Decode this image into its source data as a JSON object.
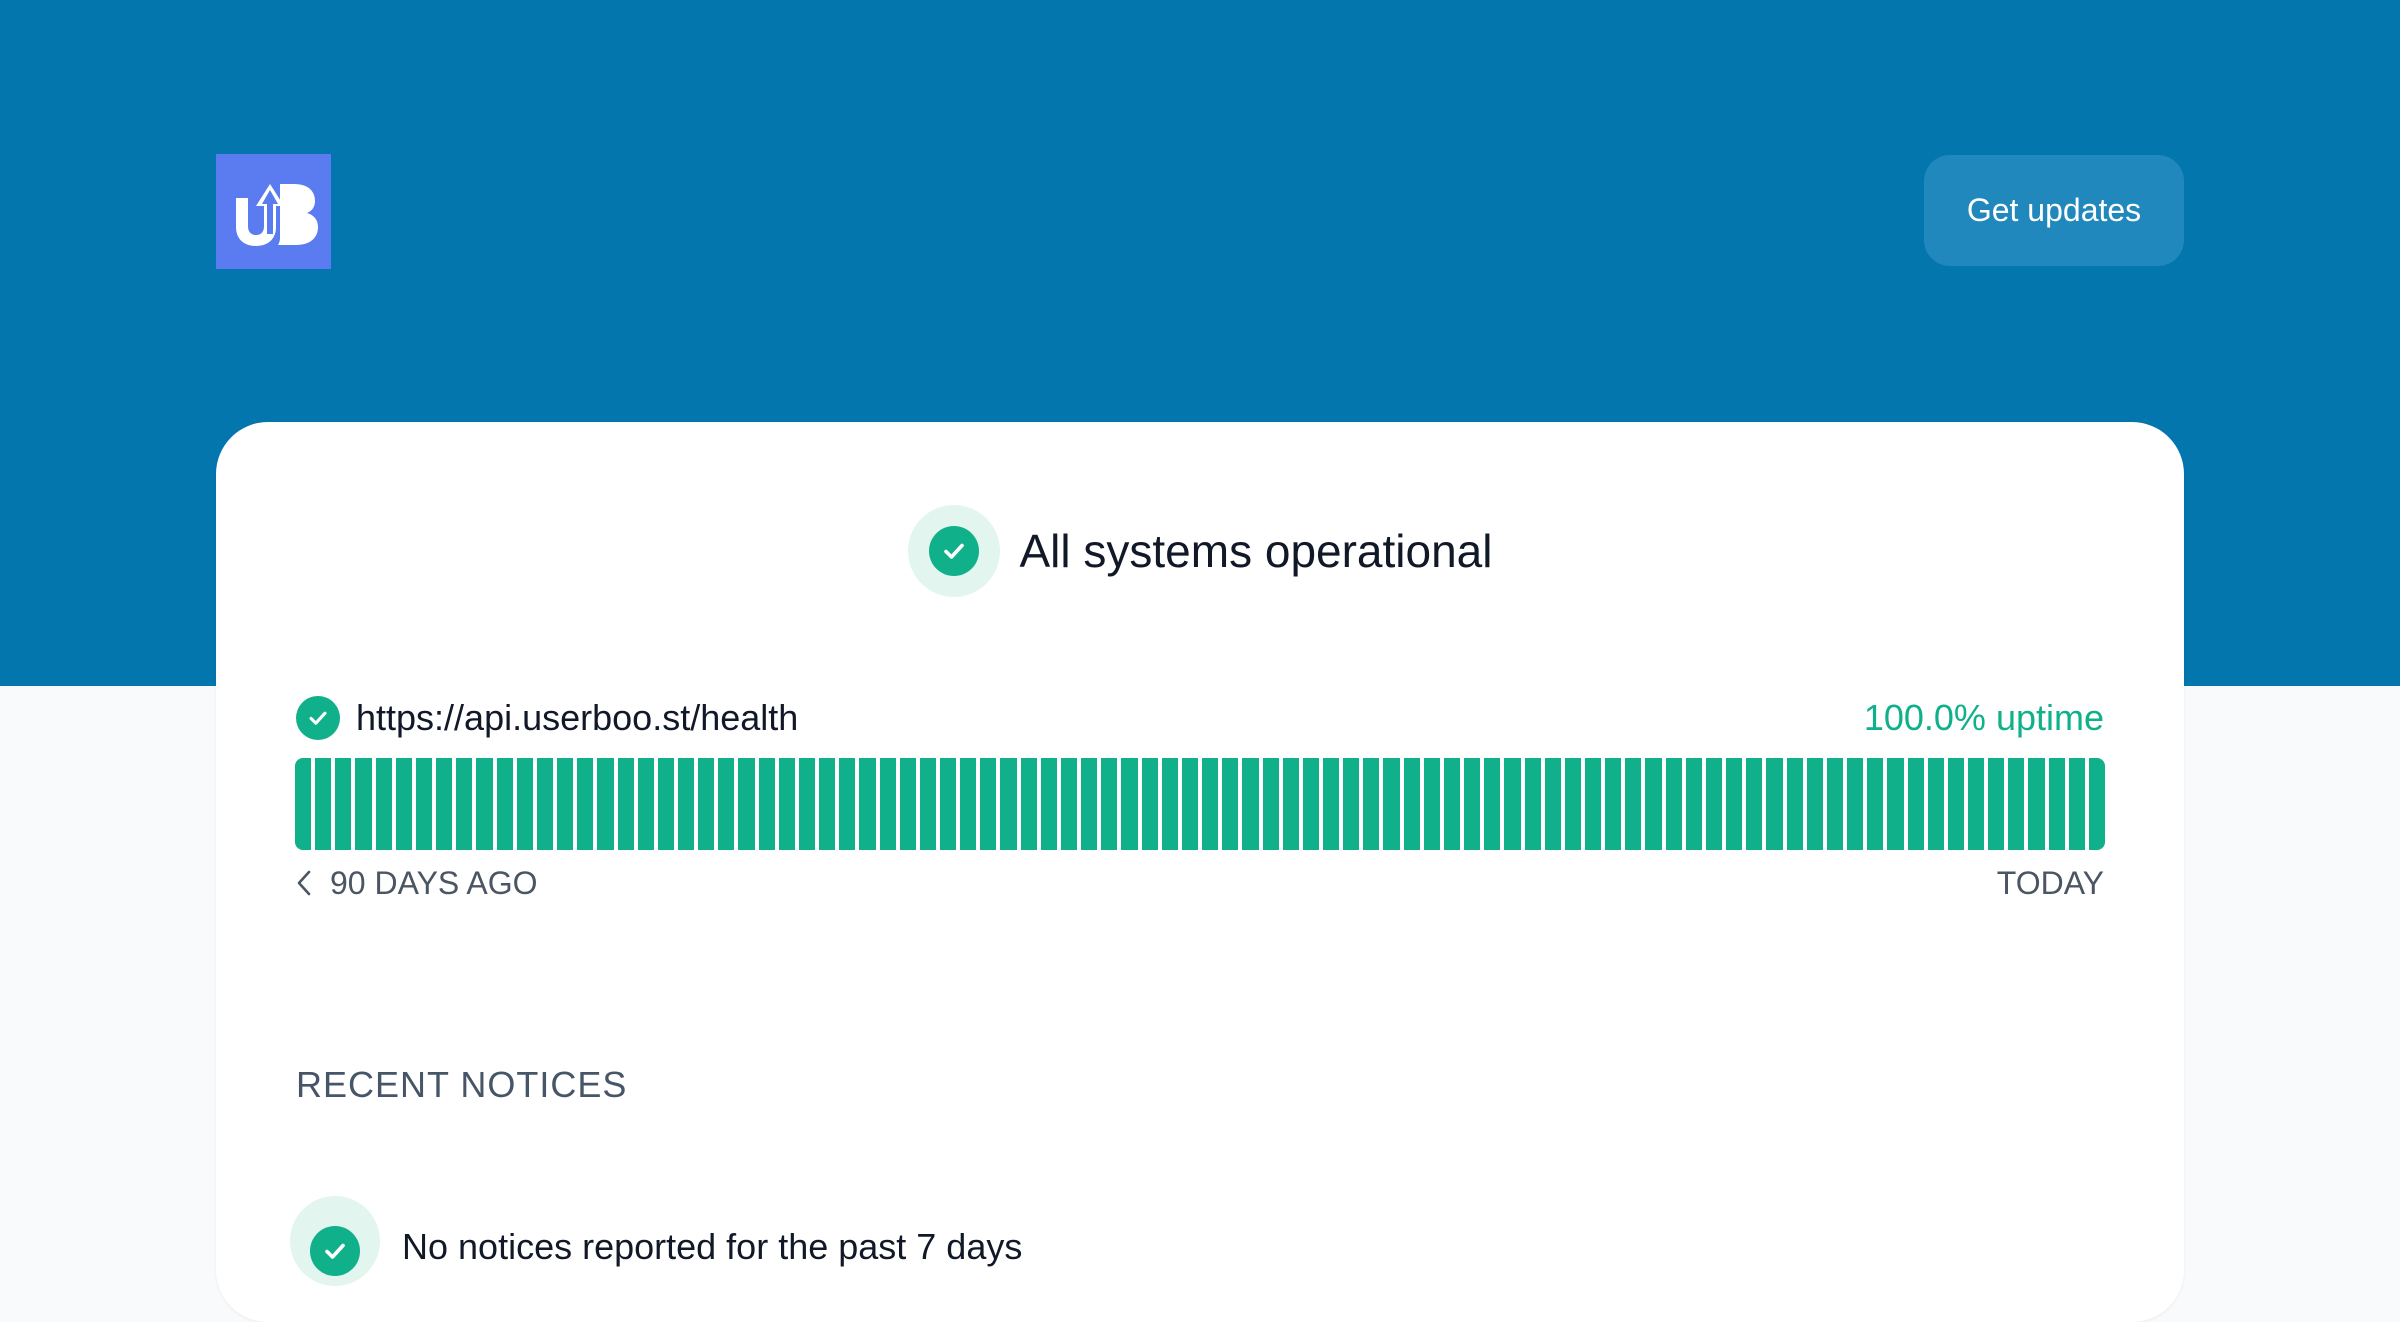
{
  "colors": {
    "hero": "#0476ae",
    "page_background": "#f8fafc",
    "logo": "#5b7cf0",
    "button": "#2088bd",
    "operational": "#10b08a",
    "check_halo": "#e2f5ef"
  },
  "header": {
    "logo_icon": "userboost-logo-icon",
    "get_updates_label": "Get updates"
  },
  "status": {
    "icon": "check-circle-icon",
    "title": "All systems operational"
  },
  "monitor": {
    "icon": "check-circle-icon",
    "url": "https://api.userboo.st/health",
    "uptime": "100.0% uptime",
    "days": 90,
    "day_status": "operational",
    "range_start_icon": "chevron-left-icon",
    "range_start": "90 DAYS AGO",
    "range_end": "TODAY"
  },
  "notices": {
    "heading": "RECENT NOTICES",
    "items": [
      {
        "icon": "check-circle-icon",
        "text": "No notices reported for the past 7 days"
      }
    ]
  }
}
